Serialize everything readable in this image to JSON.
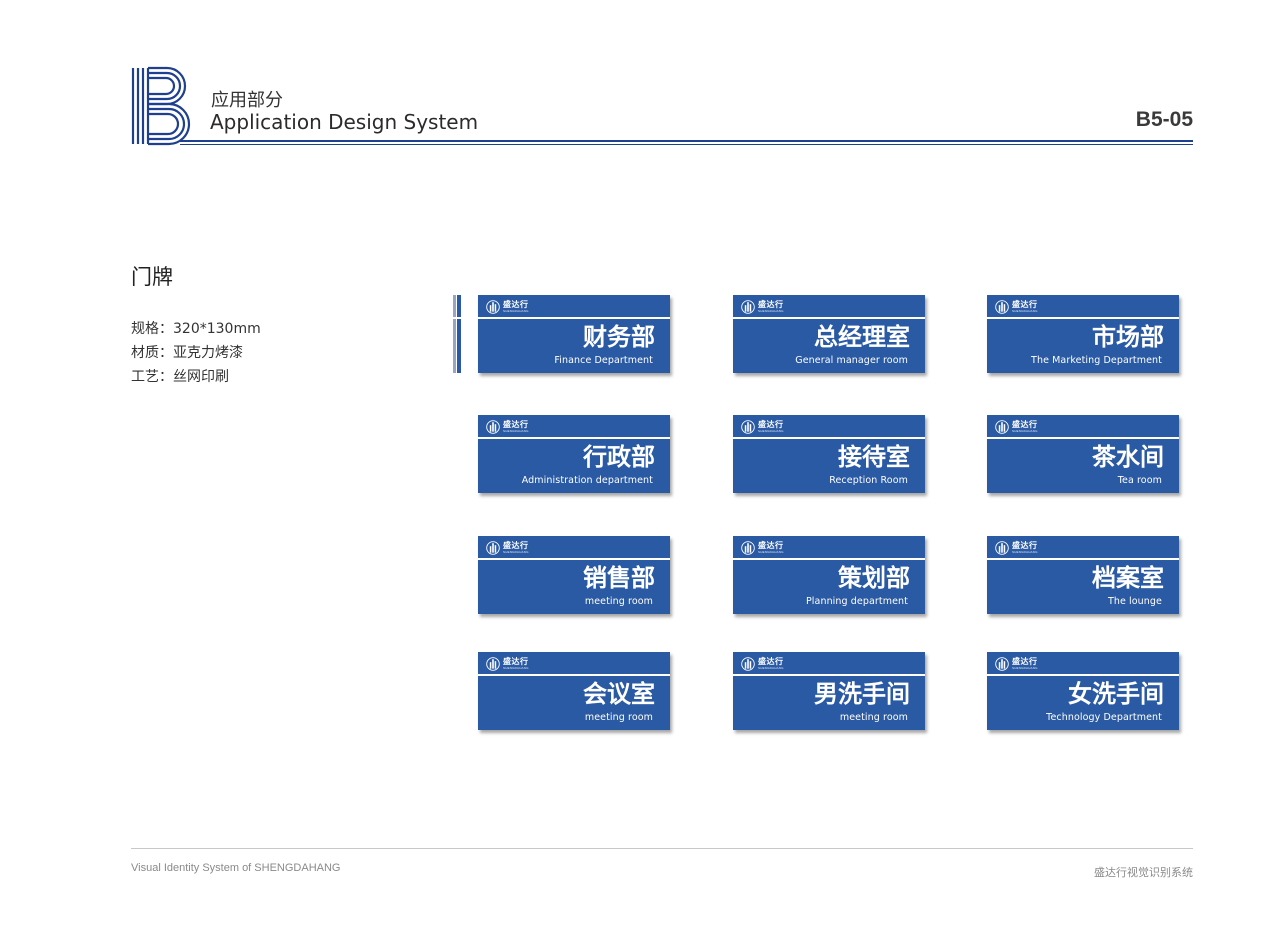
{
  "header": {
    "logo_letter": "B",
    "section_cn": "应用部分",
    "section_en": "Application Design System",
    "page_code": "B5-05"
  },
  "content": {
    "title": "门牌",
    "specs": [
      "规格：320*130mm",
      "材质：亚克力烤漆",
      "工艺：丝网印刷"
    ]
  },
  "signs": [
    {
      "cn": "财务部",
      "en": "Finance Department"
    },
    {
      "cn": "总经理室",
      "en": "General manager room"
    },
    {
      "cn": "市场部",
      "en": "The Marketing Department"
    },
    {
      "cn": "行政部",
      "en": "Administration department"
    },
    {
      "cn": "接待室",
      "en": "Reception Room"
    },
    {
      "cn": "茶水间",
      "en": "Tea room"
    },
    {
      "cn": "销售部",
      "en": "meeting room"
    },
    {
      "cn": "策划部",
      "en": "Planning department"
    },
    {
      "cn": "档案室",
      "en": "The lounge"
    },
    {
      "cn": "会议室",
      "en": "meeting room"
    },
    {
      "cn": "男洗手间",
      "en": "meeting room"
    },
    {
      "cn": "女洗手间",
      "en": "Technology Department"
    }
  ],
  "brand": {
    "name": "盛达行",
    "sub": "SHENGDAHANG"
  },
  "footer": {
    "left": "Visual Identity System of SHENGDAHANG",
    "right": "盛达行视觉识别系统"
  },
  "colors": {
    "sign_blue": "#2a5aa3",
    "rule_blue": "#1f3f8f"
  }
}
